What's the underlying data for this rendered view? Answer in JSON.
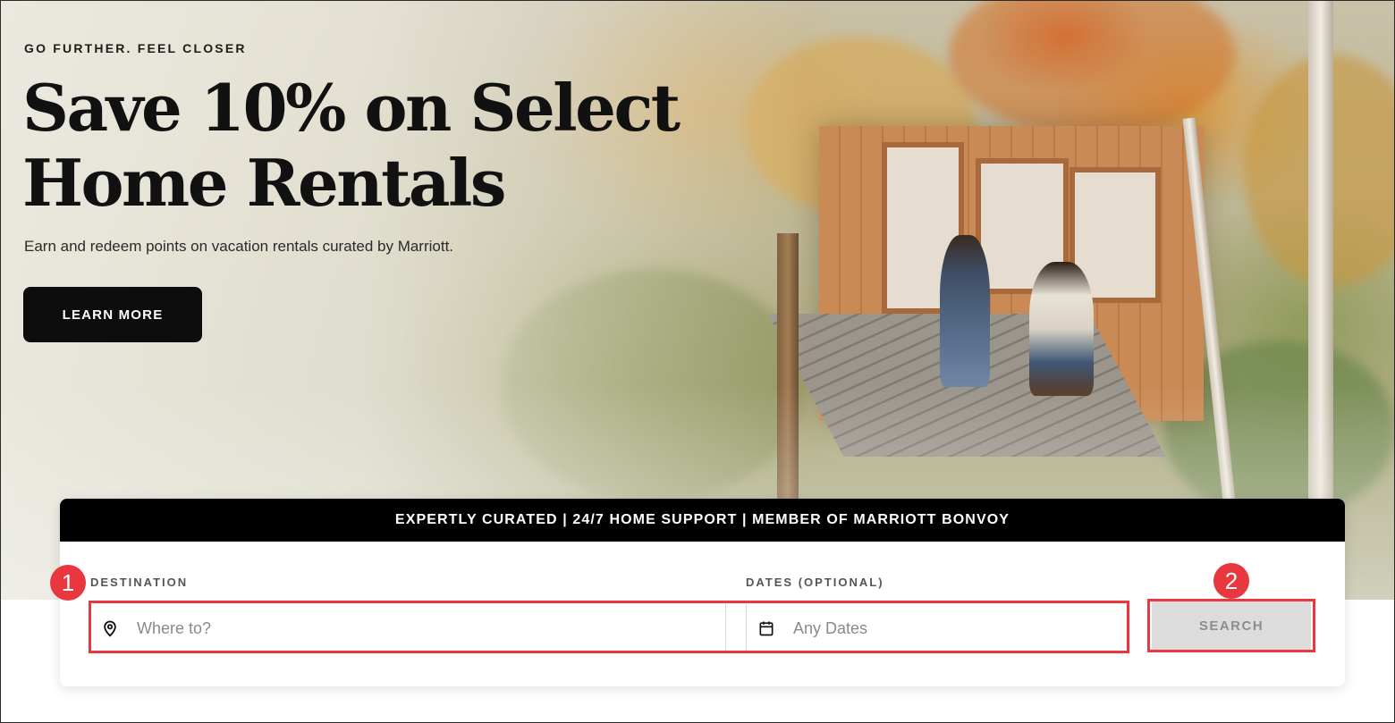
{
  "hero": {
    "eyebrow": "GO FURTHER. FEEL CLOSER",
    "headline_line1": "Save 10% on Select",
    "headline_line2": "Home Rentals",
    "subtext": "Earn and redeem points on vacation rentals curated by Marriott.",
    "cta_label": "LEARN MORE"
  },
  "search": {
    "banner": "EXPERTLY CURATED | 24/7 HOME SUPPORT | MEMBER OF MARRIOTT BONVOY",
    "destination_label": "DESTINATION",
    "destination_placeholder": "Where to?",
    "dates_label": "DATES (OPTIONAL)",
    "dates_placeholder": "Any Dates",
    "search_label": "SEARCH"
  },
  "annotations": {
    "badge1": "1",
    "badge2": "2",
    "color": "#e8373f"
  },
  "icons": {
    "destination": "map-pin-icon",
    "dates": "calendar-icon"
  }
}
